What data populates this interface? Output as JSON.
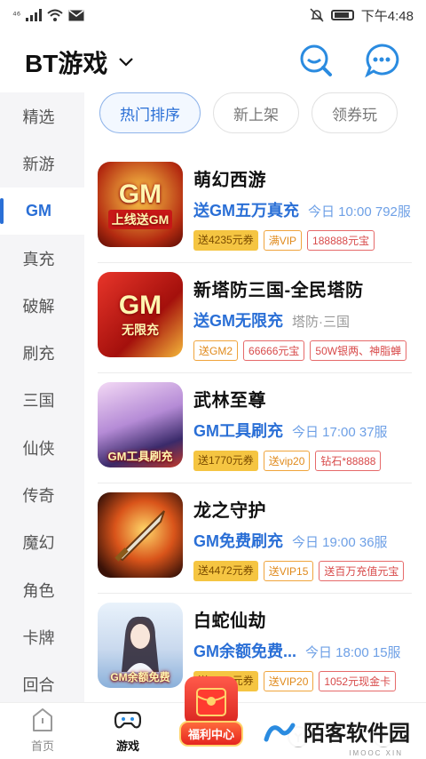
{
  "status_bar": {
    "signal_text": "⁴⁶",
    "time": "下午4:48"
  },
  "header": {
    "title": "BT游戏",
    "icons": [
      "search-icon",
      "chat-icon"
    ]
  },
  "sidebar": {
    "items": [
      {
        "label": "精选",
        "active": false
      },
      {
        "label": "新游",
        "active": false
      },
      {
        "label": "GM",
        "active": true
      },
      {
        "label": "真充",
        "active": false
      },
      {
        "label": "破解",
        "active": false
      },
      {
        "label": "刷充",
        "active": false
      },
      {
        "label": "三国",
        "active": false
      },
      {
        "label": "仙侠",
        "active": false
      },
      {
        "label": "传奇",
        "active": false
      },
      {
        "label": "魔幻",
        "active": false
      },
      {
        "label": "角色",
        "active": false
      },
      {
        "label": "卡牌",
        "active": false
      },
      {
        "label": "回合",
        "active": false
      }
    ]
  },
  "tabs": [
    {
      "label": "热门排序",
      "active": true
    },
    {
      "label": "新上架",
      "active": false
    },
    {
      "label": "领券玩",
      "active": false
    }
  ],
  "games": [
    {
      "name": "萌幻西游",
      "promo": "送GM五万真充",
      "meta": "今日 10:00 792服",
      "cover_text": "GM",
      "cover_sub": "上线送GM",
      "tags": [
        {
          "text": "送4235元券",
          "style": "gold"
        },
        {
          "text": "满VIP",
          "style": "orange"
        },
        {
          "text": "188888元宝",
          "style": "red"
        }
      ]
    },
    {
      "name": "新塔防三国-全民塔防",
      "promo": "送GM无限充",
      "meta": "塔防·三国",
      "cover_text": "GM",
      "cover_sub": "无限充",
      "tags": [
        {
          "text": "送GM2",
          "style": "orange"
        },
        {
          "text": "66666元宝",
          "style": "red"
        },
        {
          "text": "50W银两、神脂蝉",
          "style": "red"
        }
      ]
    },
    {
      "name": "武林至尊",
      "promo": "GM工具刷充",
      "meta": "今日 17:00 37服",
      "cover_text": "GM工具刷充",
      "cover_sub": "",
      "tags": [
        {
          "text": "送1770元券",
          "style": "gold"
        },
        {
          "text": "送vip20",
          "style": "orange"
        },
        {
          "text": "钻石*88888",
          "style": "red"
        }
      ]
    },
    {
      "name": "龙之守护",
      "promo": "GM免费刷充",
      "meta": "今日 19:00 36服",
      "cover_text": "",
      "cover_sub": "",
      "tags": [
        {
          "text": "送4472元券",
          "style": "gold"
        },
        {
          "text": "送VIP15",
          "style": "orange"
        },
        {
          "text": "送百万充值元宝",
          "style": "red"
        }
      ]
    },
    {
      "name": "白蛇仙劫",
      "promo": "GM余额免费...",
      "meta": "今日 18:00 15服",
      "cover_text": "GM余额免费",
      "cover_sub": "",
      "tags": [
        {
          "text": "送6021元券",
          "style": "gold"
        },
        {
          "text": "送VIP20",
          "style": "orange"
        },
        {
          "text": "1052元现金卡",
          "style": "red"
        }
      ]
    }
  ],
  "bottom_nav": [
    {
      "label": "首页",
      "icon": "home-icon",
      "active": false
    },
    {
      "label": "游戏",
      "icon": "gamepad-icon",
      "active": true
    },
    {
      "label": "福利中心",
      "icon": "red-envelope-icon",
      "active": false
    },
    {
      "label": "",
      "icon": "trade-icon",
      "active": false
    },
    {
      "label": "",
      "icon": "profile-icon",
      "active": false
    }
  ],
  "watermark": {
    "text": "陌客软件园",
    "sub": "IMOOC XIN"
  },
  "colors": {
    "accent": "#2a6fd6",
    "tag_gold": "#f5c542",
    "tag_orange": "#e08a1c",
    "tag_red": "#d84a4a"
  }
}
